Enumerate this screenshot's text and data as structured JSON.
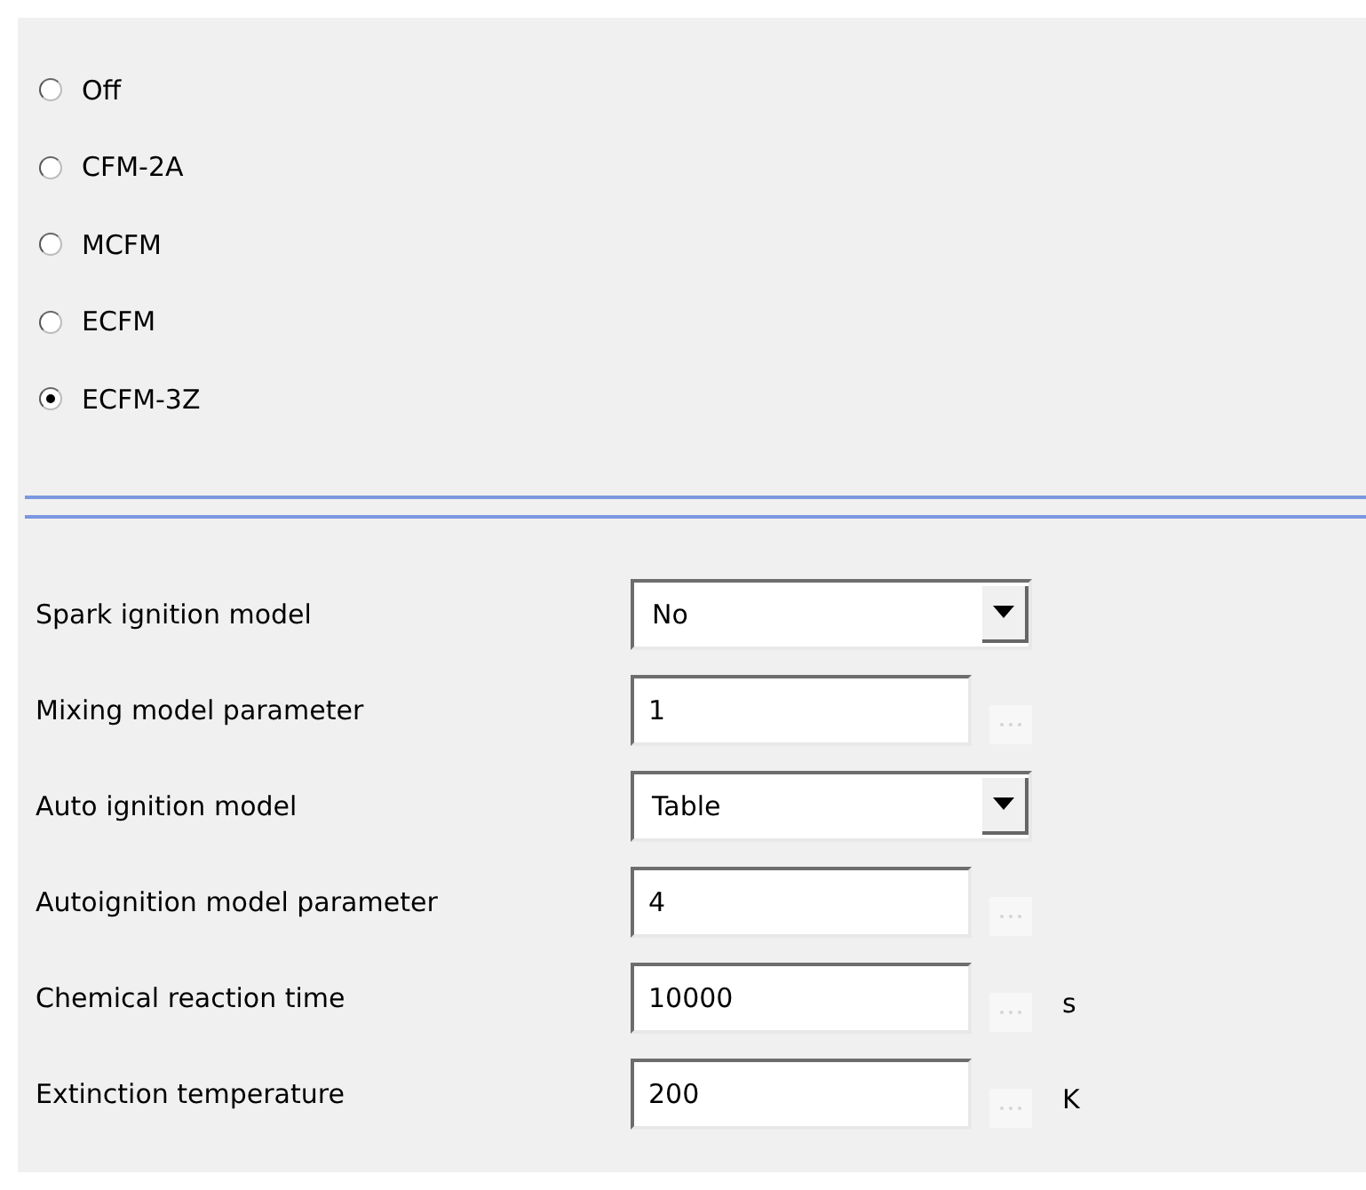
{
  "model_options": [
    {
      "label": "Off",
      "selected": false
    },
    {
      "label": "CFM-2A",
      "selected": false
    },
    {
      "label": "MCFM",
      "selected": false
    },
    {
      "label": "ECFM",
      "selected": false
    },
    {
      "label": "ECFM-3Z",
      "selected": true
    }
  ],
  "parameters": [
    {
      "kind": "dropdown",
      "label": "Spark ignition model",
      "value": "No"
    },
    {
      "kind": "text",
      "label": "Mixing model parameter",
      "value": "1",
      "browse_disabled": true
    },
    {
      "kind": "dropdown",
      "label": "Auto ignition model",
      "value": "Table"
    },
    {
      "kind": "text",
      "label": "Autoignition model parameter",
      "value": "4",
      "browse_disabled": true
    },
    {
      "kind": "text",
      "label": "Chemical reaction time",
      "value": "10000",
      "browse_disabled": true,
      "unit": "s"
    },
    {
      "kind": "text",
      "label": "Extinction temperature",
      "value": "200",
      "browse_disabled": true,
      "unit": "K"
    }
  ]
}
